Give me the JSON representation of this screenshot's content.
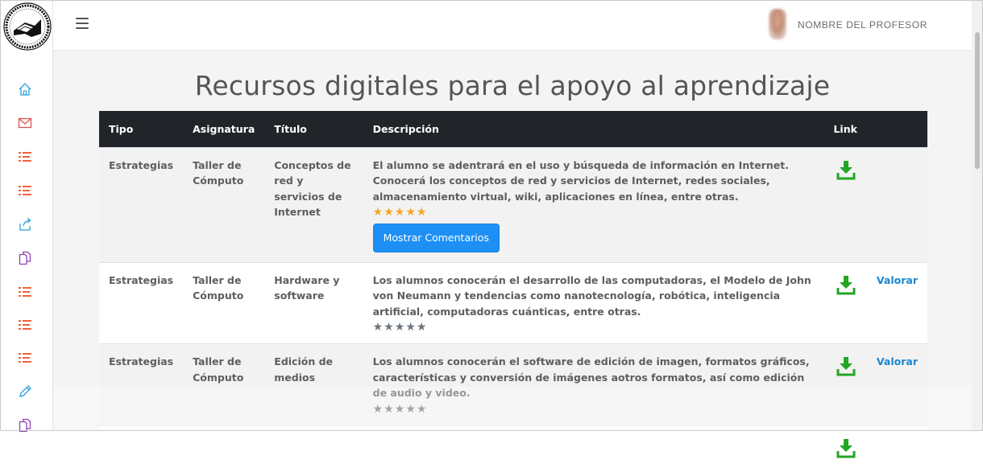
{
  "header": {
    "professor_name": "NOMBRE DEL PROFESOR"
  },
  "sidebar": {
    "icons": [
      {
        "name": "home-icon",
        "color": "#2aa1d8"
      },
      {
        "name": "mail-icon",
        "color": "#d9534f"
      },
      {
        "name": "list-icon",
        "color": "#f0643a"
      },
      {
        "name": "list-icon",
        "color": "#f0643a"
      },
      {
        "name": "share-icon",
        "color": "#2aa1d8"
      },
      {
        "name": "copy-icon",
        "color": "#8e44ad"
      },
      {
        "name": "list-icon",
        "color": "#f0643a"
      },
      {
        "name": "list-icon",
        "color": "#f0643a"
      },
      {
        "name": "list-icon",
        "color": "#f0643a"
      },
      {
        "name": "pencil-icon",
        "color": "#2aa1d8"
      },
      {
        "name": "copy-icon",
        "color": "#8e44ad"
      }
    ]
  },
  "main": {
    "title": "Recursos digitales para el apoyo al aprendizaje",
    "table": {
      "headers": {
        "tipo": "Tipo",
        "asignatura": "Asignatura",
        "titulo": "Título",
        "descripcion": "Descripción",
        "link": "Link"
      },
      "rows": [
        {
          "tipo": "Estrategias",
          "asignatura": "Taller de Cómputo",
          "titulo": "Conceptos de red y servicios de Internet",
          "descripcion": "El alumno se adentrará en el uso y búsqueda de información en Internet. Conocerá los conceptos de red y servicios de Internet, redes sociales, almacenamiento virtual, wiki, aplicaciones en línea, entre otras.",
          "rating": 5,
          "comments_button": "Mostrar Comentarios",
          "valorar": ""
        },
        {
          "tipo": "Estrategias",
          "asignatura": "Taller de Cómputo",
          "titulo": "Hardware y software",
          "descripcion": "Los alumnos conocerán el desarrollo de las computadoras, el Modelo de John von Neumann y tendencias como nanotecnología, robótica, inteligencia artificial, computadoras cuánticas, entre otras.",
          "rating": 0,
          "comments_button": "",
          "valorar": "Valorar"
        },
        {
          "tipo": "Estrategias",
          "asignatura": "Taller de Cómputo",
          "titulo": "Edición de medios",
          "descripcion": "Los alumnos conocerán el software de edición de imagen, formatos gráficos, características y conversión de imágenes aotros formatos, así como edición de audio y video.",
          "rating": 0,
          "comments_button": "",
          "valorar": "Valorar"
        },
        {
          "tipo": "",
          "asignatura": "",
          "titulo": "",
          "descripcion": "",
          "rating": null,
          "comments_button": "",
          "valorar": ""
        }
      ]
    },
    "colors": {
      "header_bg": "#212529",
      "star_filled": "#f5a623",
      "star_empty": "#6c757d",
      "download_green": "#23a623",
      "button_blue": "#1e90f5",
      "link_blue": "#1c86d1"
    }
  }
}
